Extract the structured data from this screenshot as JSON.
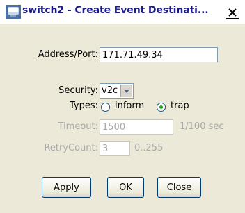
{
  "window": {
    "title": "switch2 - Create Event Destinati...",
    "close_glyph": "✕",
    "app_icon": "computer-icon"
  },
  "form": {
    "address_label": "Address/Port:",
    "address_value": "171.71.49.34",
    "security_label": "Security:",
    "security_value": "v2c",
    "types_label": "Types:",
    "types_options": [
      {
        "label": "inform",
        "selected": false
      },
      {
        "label": "trap",
        "selected": true
      }
    ],
    "timeout_label": "Timeout:",
    "timeout_value": "1500",
    "timeout_unit": "1/100 sec",
    "retry_label": "RetryCount:",
    "retry_value": "3",
    "retry_range": "0..255"
  },
  "buttons": {
    "apply": "Apply",
    "ok": "OK",
    "close": "Close"
  },
  "colors": {
    "title_text": "#1a1a8c",
    "dialog_bg": "#ece9d8",
    "disabled_text": "#a8a8a8",
    "radio_dot": "#21a121"
  }
}
